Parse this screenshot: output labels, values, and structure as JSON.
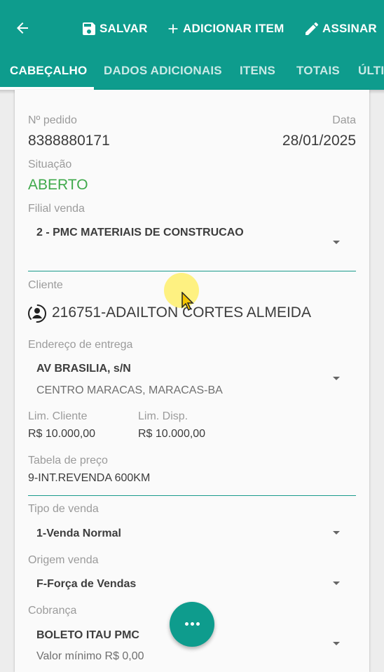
{
  "toolbar": {
    "save_label": "SALVAR",
    "add_item_label": "ADICIONAR ITEM",
    "sign_label": "ASSINAR"
  },
  "tabs": [
    {
      "label": "CABEÇALHO",
      "active": true
    },
    {
      "label": "DADOS ADICIONAIS",
      "active": false
    },
    {
      "label": "ITENS",
      "active": false
    },
    {
      "label": "TOTAIS",
      "active": false
    },
    {
      "label": "ÚLTI",
      "active": false
    }
  ],
  "order": {
    "number_label": "Nº pedido",
    "number": "8388880171",
    "date_label": "Data",
    "date": "28/01/2025",
    "status_label": "Situação",
    "status": "ABERTO",
    "branch_label": "Filial venda",
    "branch": "2 - PMC MATERIAIS DE CONSTRUCAO"
  },
  "client": {
    "label": "Cliente",
    "name": "216751-ADAILTON CORTES ALMEIDA",
    "address_label": "Endereço de entrega",
    "address_line1": "AV BRASILIA, s/N",
    "address_line2": "CENTRO MARACAS, MARACAS-BA",
    "limit_label": "Lim. Cliente",
    "limit": "R$ 10.000,00",
    "available_label": "Lim. Disp.",
    "available": "R$ 10.000,00",
    "price_table_label": "Tabela de preço",
    "price_table": "9-INT.REVENDA 600KM"
  },
  "sale": {
    "type_label": "Tipo de venda",
    "type": "1-Venda Normal",
    "origin_label": "Origem venda",
    "origin": "F-Força de Vendas",
    "billing_label": "Cobrança",
    "billing": "BOLETO ITAU PMC",
    "billing_min": "Valor mínimo R$ 0,00"
  },
  "colors": {
    "primary": "#0e9c8d",
    "status_green": "#3fa94b"
  }
}
